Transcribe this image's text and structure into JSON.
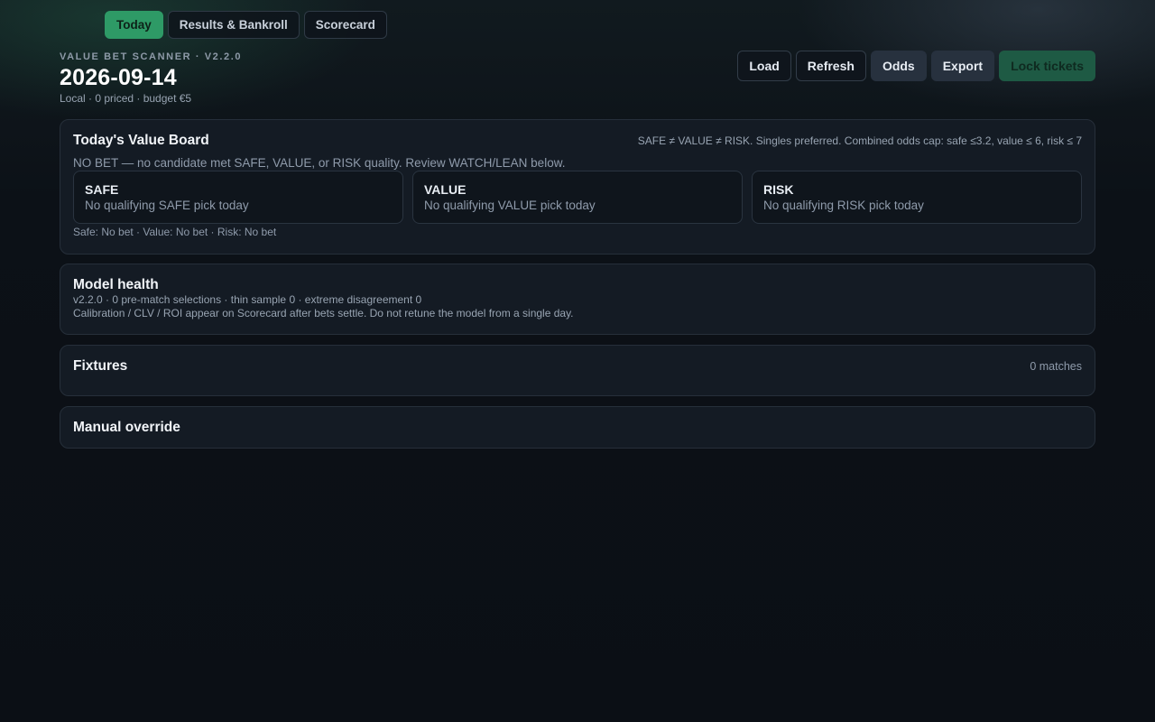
{
  "nav": {
    "tabs": [
      {
        "label": "Today",
        "active": true
      },
      {
        "label": "Results & Bankroll",
        "active": false
      },
      {
        "label": "Scorecard",
        "active": false
      }
    ]
  },
  "header": {
    "eyebrow": "VALUE BET SCANNER · V2.2.0",
    "date": "2026-09-14",
    "subtitle": "Local · 0 priced · budget €5"
  },
  "actions": {
    "load": "Load",
    "refresh": "Refresh",
    "odds": "Odds",
    "export": "Export",
    "lock": "Lock tickets"
  },
  "value_board": {
    "title": "Today's Value Board",
    "note": "SAFE ≠ VALUE ≠ RISK. Singles preferred. Combined odds cap: safe ≤3.2, value ≤ 6, risk ≤ 7",
    "no_bet": "NO BET — no candidate met SAFE, VALUE, or RISK quality. Review WATCH/LEAN below.",
    "cards": [
      {
        "title": "SAFE",
        "text": "No qualifying SAFE pick today"
      },
      {
        "title": "VALUE",
        "text": "No qualifying VALUE pick today"
      },
      {
        "title": "RISK",
        "text": "No qualifying RISK pick today"
      }
    ],
    "summary": "Safe: No bet · Value: No bet · Risk: No bet"
  },
  "model_health": {
    "title": "Model health",
    "line1": "v2.2.0 · 0 pre-match selections · thin sample 0 · extreme disagreement 0",
    "line2": "Calibration / CLV / ROI appear on Scorecard after bets settle. Do not retune the model from a single day."
  },
  "fixtures": {
    "title": "Fixtures",
    "count": "0 matches"
  },
  "manual_override": {
    "title": "Manual override"
  },
  "colors": {
    "accent": "#2e9a66",
    "lock": "#1e5a44",
    "panel": "#141b24"
  }
}
